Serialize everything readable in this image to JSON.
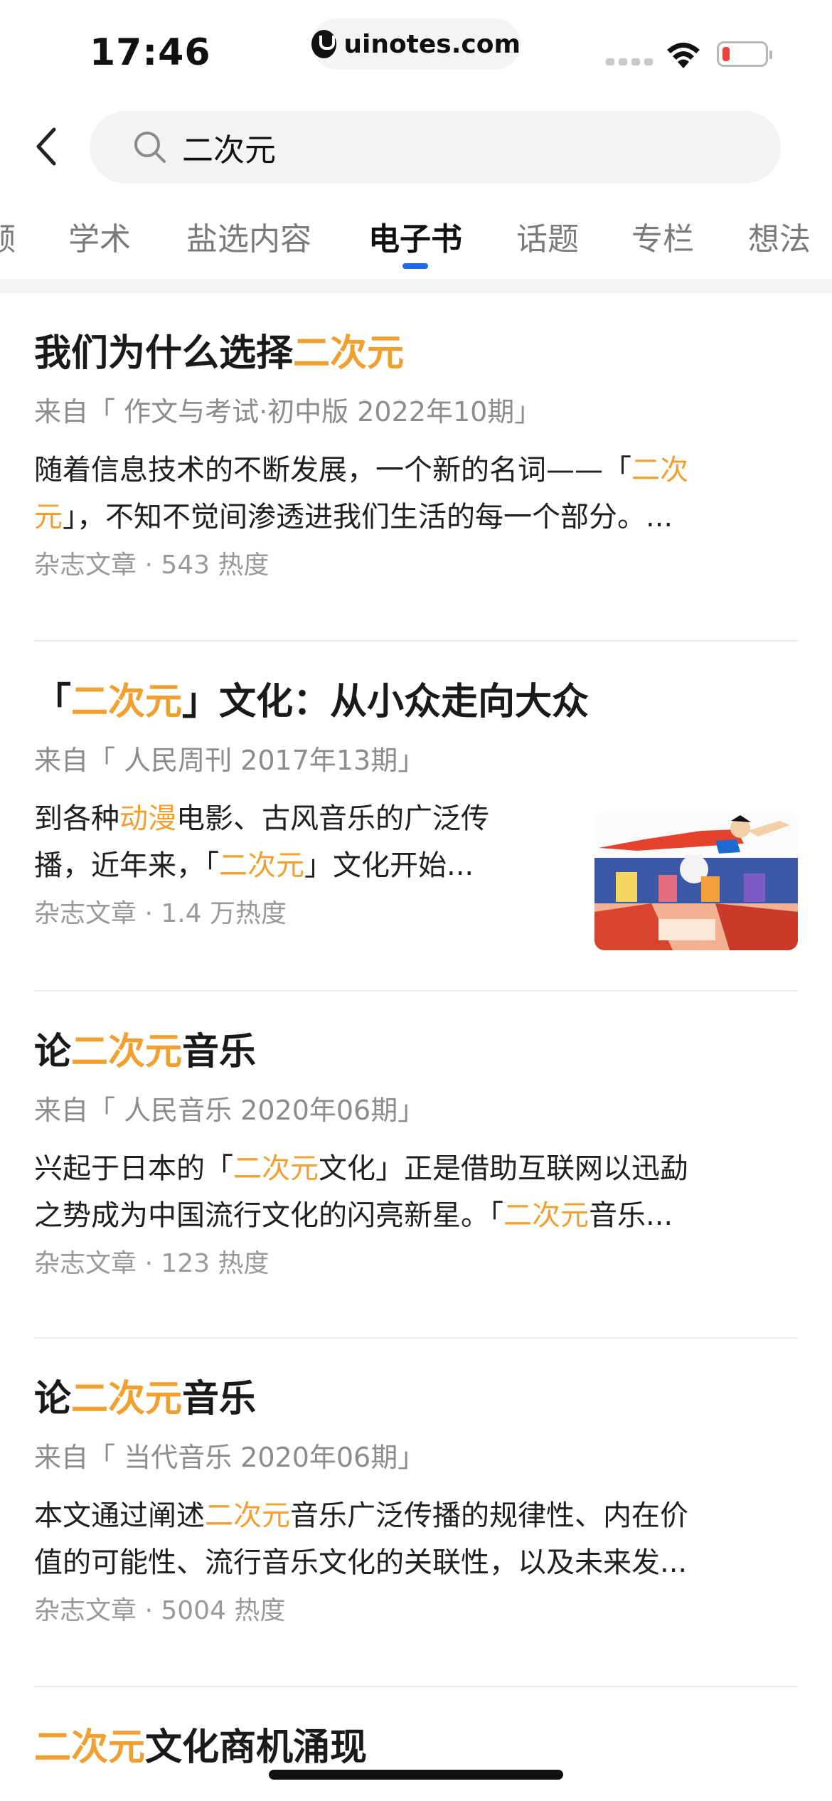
{
  "status_bar": {
    "time": "17:46",
    "site": "uinotes.com",
    "icons": [
      "signal-icon",
      "wifi-icon",
      "battery-low-icon"
    ],
    "battery_color": "#e8423a"
  },
  "search": {
    "query": "二次元",
    "icons": [
      "back-icon",
      "search-icon"
    ]
  },
  "tabs": [
    {
      "label": "频"
    },
    {
      "label": "学术"
    },
    {
      "label": "盐选内容"
    },
    {
      "label": "电子书",
      "active": true
    },
    {
      "label": "话题"
    },
    {
      "label": "专栏"
    },
    {
      "label": "想法"
    }
  ],
  "accent_color": "#1a6bf0",
  "highlight_color": "#f0a030",
  "results": [
    {
      "title": {
        "pre": "我们为什么选择",
        "hl": "二次元",
        "post": ""
      },
      "source": "来自「 作文与考试·初中版 2022年10期」",
      "body": {
        "l1_pre": "随着信息技术的不断发展，一个新的名词——「",
        "l1_hl": "二次",
        "l2_hl": "元",
        "l2_post": "」，不知不觉间渗透进我们生活的每一个部分。..."
      },
      "meta": "杂志文章 · 543 热度"
    },
    {
      "title": {
        "pre": "「",
        "hl": "二次元",
        "post": "」文化：从小众走向大众"
      },
      "source": "来自「 人民周刊 2017年13期」",
      "body": {
        "l1_pre": "到各种",
        "l1_hl": "动漫",
        "l1_post": "电影、古风音乐的广泛传",
        "l2_pre": "播，近年来，「",
        "l2_hl": "二次元",
        "l2_post": "」文化开始..."
      },
      "meta": "杂志文章 · 1.4 万热度",
      "thumbnail": "anime-collage-image"
    },
    {
      "title": {
        "pre": "论",
        "hl": "二次元",
        "post": "音乐"
      },
      "source": "来自「 人民音乐 2020年06期」",
      "body": {
        "l1_pre": "兴起于日本的「",
        "l1_hl": "二次元",
        "l1_post": "文化」正是借助互联网以迅勐",
        "l2_pre": "之势成为中国流行文化的闪亮新星。「",
        "l2_hl": "二次元",
        "l2_post": "音乐..."
      },
      "meta": "杂志文章 · 123 热度"
    },
    {
      "title": {
        "pre": "论",
        "hl": "二次元",
        "post": "音乐"
      },
      "source": "来自「 当代音乐 2020年06期」",
      "body": {
        "l1_pre": "本文通过阐述",
        "l1_hl": "二次元",
        "l1_post": "音乐广泛传播的规律性、内在价",
        "l2_pre": "值的可能性、流行音乐文化的关联性，以及未来发..."
      },
      "meta": "杂志文章 · 5004 热度"
    },
    {
      "title": {
        "pre": "",
        "hl": "二次元",
        "post": "文化商机涌现"
      }
    }
  ]
}
